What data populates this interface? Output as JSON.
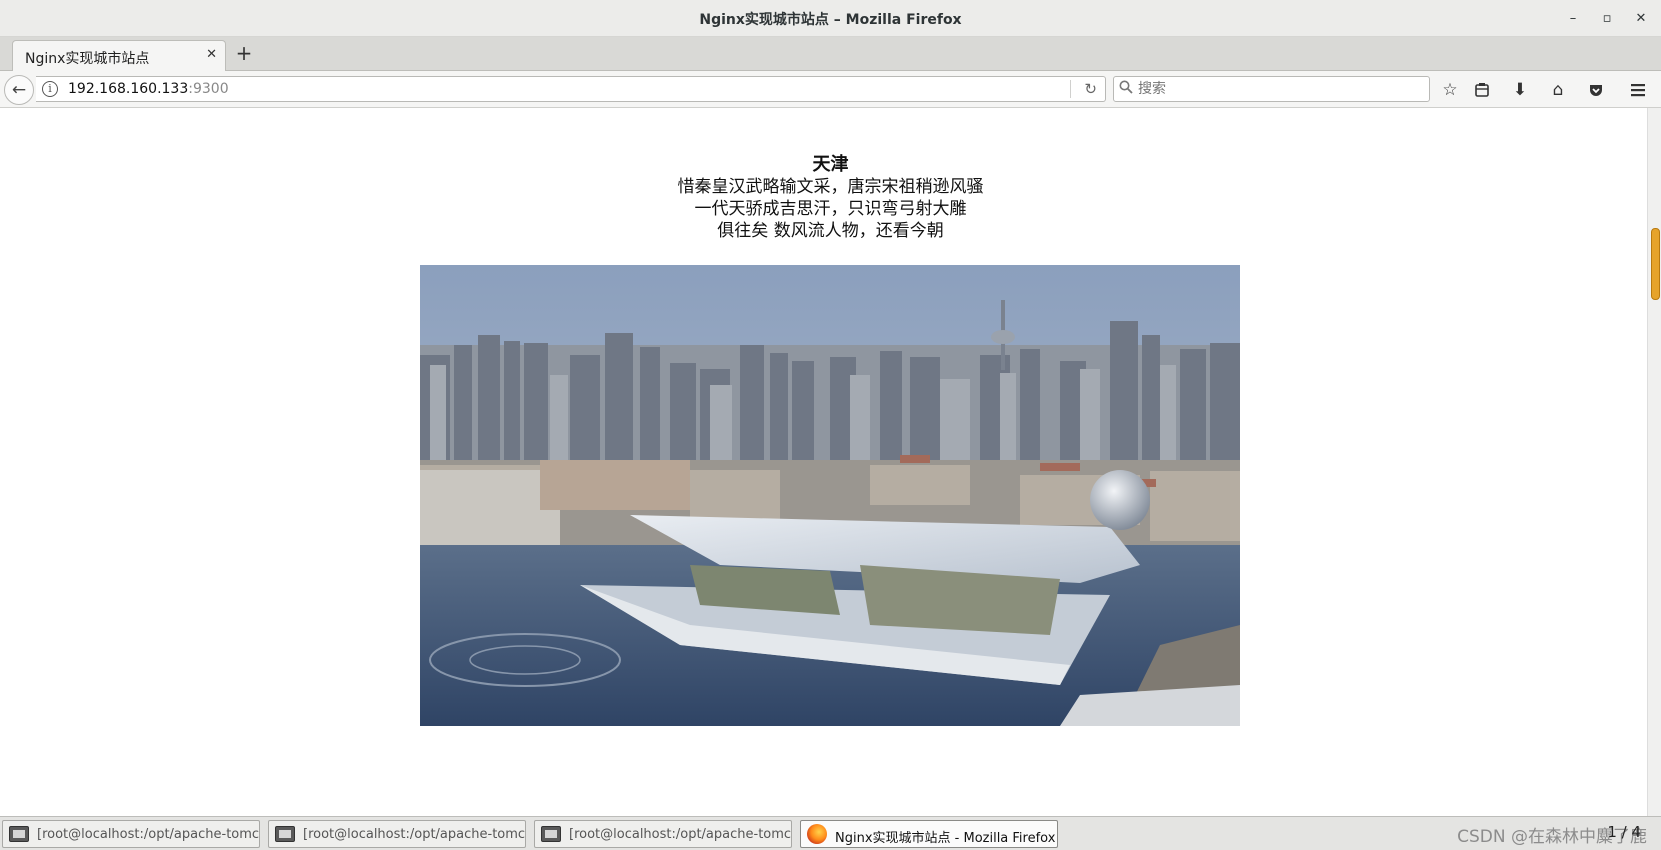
{
  "window": {
    "title": "Nginx实现城市站点 – Mozilla Firefox",
    "controls": {
      "minimize": "–",
      "maximize": "▫",
      "close": "✕"
    }
  },
  "tabs": [
    {
      "title": "Nginx实现城市站点",
      "close": "✕",
      "active": true
    }
  ],
  "new_tab": "+",
  "navbar": {
    "back_icon": "←",
    "info_icon": "i",
    "url_host": "192.168.160.133",
    "url_port": ":9300",
    "reload_icon": "↻",
    "search_placeholder": "搜索",
    "search_icon": "⚲",
    "toolbar": {
      "bookmark": "☆",
      "reading_list": "☰",
      "downloads": "⬇",
      "home": "⌂",
      "pocket": "⛉",
      "menu": "≡"
    }
  },
  "page": {
    "city": "天津",
    "lines": [
      "惜秦皇汉武略输文采，唐宗宋祖稍逊风骚",
      "一代天骄成吉思汗，只识弯弓射大雕",
      "俱往矣 数风流人物，还看今朝"
    ]
  },
  "taskbar": {
    "items": [
      {
        "label": "[root@localhost:/opt/apache-tomca…",
        "active": false
      },
      {
        "label": "[root@localhost:/opt/apache-tomca…",
        "active": false
      },
      {
        "label": "[root@localhost:/opt/apache-tomca…",
        "active": false
      },
      {
        "label": "Nginx实现城市站点 - Mozilla Firefox",
        "active": true
      }
    ],
    "watermark": "CSDN @在森林中麋了鹿",
    "pager": "1 / 4"
  },
  "colors": {
    "accent_scroll": "#e6a32b",
    "chrome_bg": "#ececea"
  }
}
